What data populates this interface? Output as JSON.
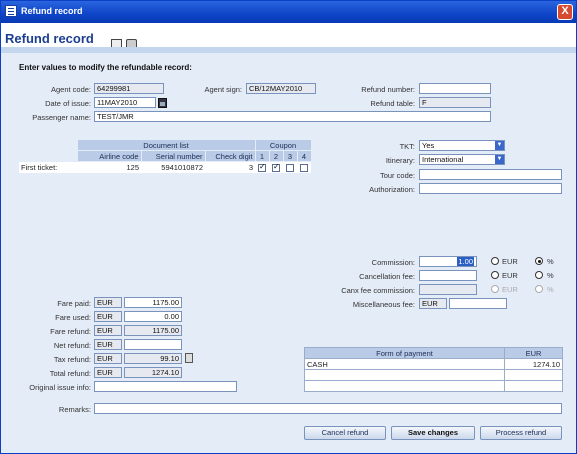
{
  "window": {
    "title": "Refund record",
    "close_glyph": "X"
  },
  "header": {
    "title": "Refund record",
    "icons": [
      "document-icon",
      "printer-icon"
    ]
  },
  "instructions": "Enter values to modify the refundable record:",
  "top_fields": {
    "agent_code": {
      "label": "Agent code:",
      "value": "64299981"
    },
    "agent_sign": {
      "label": "Agent sign:",
      "value": "CB/12MAY2010"
    },
    "refund_number": {
      "label": "Refund number:",
      "value": ""
    },
    "date_of_issue": {
      "label": "Date of issue:",
      "value": "11MAY2010"
    },
    "refund_table": {
      "label": "Refund table:",
      "value": "F"
    },
    "passenger_name": {
      "label": "Passenger name:",
      "value": "TEST/JMR"
    }
  },
  "document_list": {
    "title": "Document list",
    "coupon_title": "Coupon",
    "columns": [
      "Airline code",
      "Serial number",
      "Check digit",
      "1",
      "2",
      "3",
      "4"
    ],
    "rows": [
      {
        "label": "First ticket:",
        "airline_code": "125",
        "serial_number": "5941010872",
        "check_digit": "3",
        "coupons": [
          true,
          true,
          false,
          false
        ]
      }
    ]
  },
  "right_fields": {
    "tkt": {
      "label": "TKT:",
      "value": "Yes"
    },
    "itinerary": {
      "label": "Itinerary:",
      "value": "International"
    },
    "tour_code": {
      "label": "Tour code:",
      "value": ""
    },
    "authorization": {
      "label": "Authorization:",
      "value": ""
    }
  },
  "fees": {
    "commission": {
      "label": "Commission:",
      "value": "1.00",
      "eur_label": "EUR",
      "pct_label": "%",
      "selected": "%"
    },
    "cancellation_fee": {
      "label": "Cancellation fee:",
      "value": "",
      "eur_label": "EUR",
      "pct_label": "%",
      "selected": ""
    },
    "canx_fee_commission": {
      "label": "Canx fee commission:",
      "value": "",
      "eur_label": "EUR",
      "pct_label": "%",
      "selected": ""
    },
    "misc_fee": {
      "label": "Miscellaneous fee:",
      "currency": "EUR",
      "value": ""
    }
  },
  "amounts": {
    "fare_paid": {
      "label": "Fare paid:",
      "currency": "EUR",
      "value": "1175.00"
    },
    "fare_used": {
      "label": "Fare used:",
      "currency": "EUR",
      "value": "0.00"
    },
    "fare_refund": {
      "label": "Fare refund:",
      "currency": "EUR",
      "value": "1175.00"
    },
    "net_refund": {
      "label": "Net refund:",
      "currency": "EUR",
      "value": ""
    },
    "tax_refund": {
      "label": "Tax refund:",
      "currency": "EUR",
      "value": "99.10"
    },
    "total_refund": {
      "label": "Total refund:",
      "currency": "EUR",
      "value": "1274.10"
    },
    "original_issue_info": {
      "label": "Original issue info:",
      "value": ""
    }
  },
  "payment": {
    "columns": [
      "Form of payment",
      "EUR"
    ],
    "rows": [
      {
        "form": "CASH",
        "amount": "1274.10"
      },
      {
        "form": "",
        "amount": ""
      },
      {
        "form": "",
        "amount": ""
      }
    ]
  },
  "remarks": {
    "label": "Remarks:",
    "value": ""
  },
  "buttons": {
    "cancel": "Cancel refund",
    "save": "Save changes",
    "process": "Process refund"
  },
  "colors": {
    "titlebar": "#0e45c8",
    "header_title": "#1d3f8f",
    "table_header": "#b9cbe6",
    "content_bg": "#e4ecf7"
  }
}
